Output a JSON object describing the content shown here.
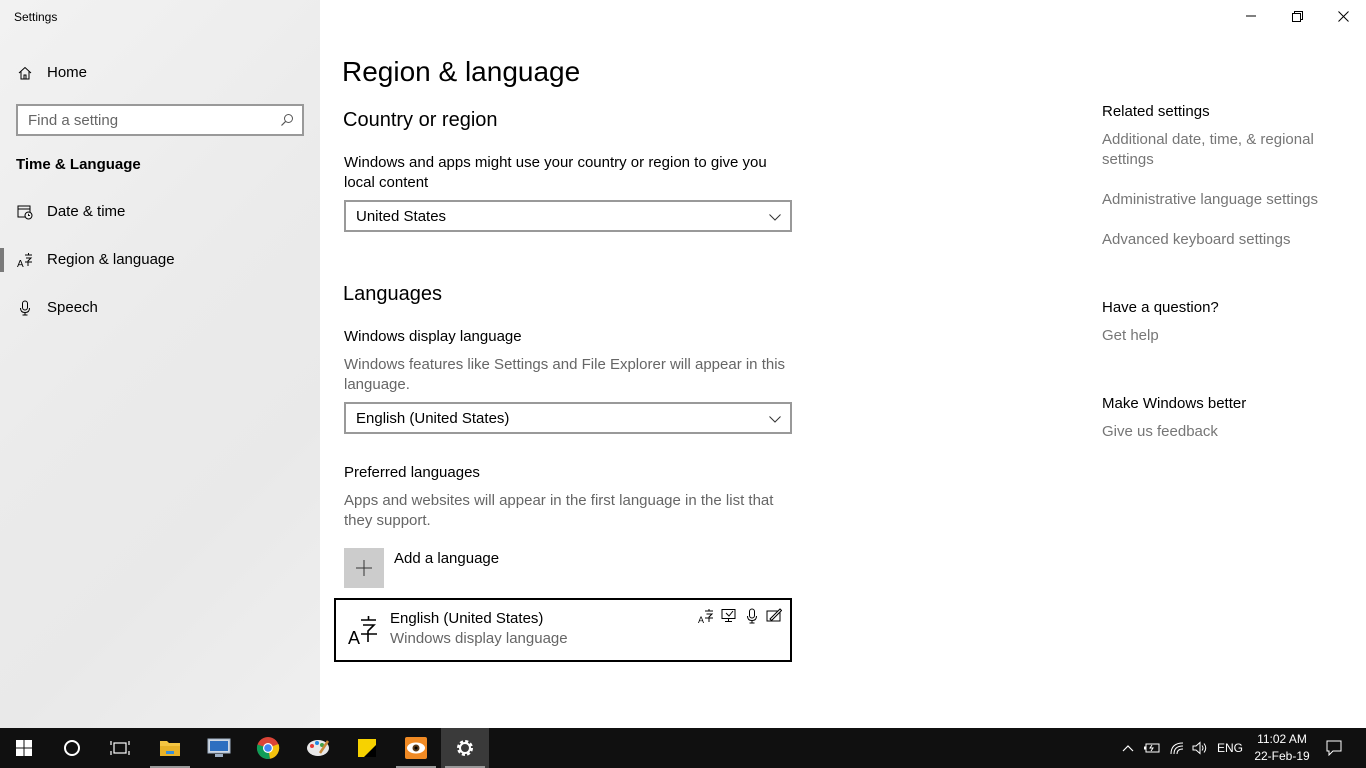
{
  "window": {
    "title": "Settings"
  },
  "sidebar": {
    "home_label": "Home",
    "search_placeholder": "Find a setting",
    "section_title": "Time & Language",
    "items": [
      {
        "label": "Date & time",
        "icon": "calendar-clock-icon"
      },
      {
        "label": "Region & language",
        "icon": "language-icon",
        "selected": true
      },
      {
        "label": "Speech",
        "icon": "microphone-icon"
      }
    ]
  },
  "main": {
    "page_title": "Region & language",
    "country": {
      "heading": "Country or region",
      "description": "Windows and apps might use your country or region to give you local content",
      "selected": "United States"
    },
    "languages": {
      "heading": "Languages",
      "display_language_label": "Windows display language",
      "display_language_desc": "Windows features like Settings and File Explorer will appear in this language.",
      "display_language_selected": "English (United States)",
      "preferred_label": "Preferred languages",
      "preferred_desc": "Apps and websites will appear in the first language in the list that they support.",
      "add_language_label": "Add a language",
      "list": [
        {
          "name": "English (United States)",
          "subtitle": "Windows display language"
        }
      ]
    }
  },
  "related": {
    "heading": "Related settings",
    "links": [
      "Additional date, time, & regional settings",
      "Administrative language settings",
      "Advanced keyboard settings"
    ],
    "question_heading": "Have a question?",
    "help_link": "Get help",
    "better_heading": "Make Windows better",
    "feedback_link": "Give us feedback"
  },
  "taskbar": {
    "apps": [
      "start-icon",
      "cortana-icon",
      "task-view-icon",
      "file-explorer-icon",
      "remote-desktop-icon",
      "chrome-icon",
      "paint-icon",
      "sticky-notes-icon",
      "eye-app-icon",
      "settings-icon"
    ],
    "input_language": "ENG",
    "time": "11:02 AM",
    "date": "22-Feb-19"
  },
  "colors": {
    "accent_grey": "#7a7a7a",
    "link_grey": "#767676",
    "taskbar": "#101010"
  }
}
